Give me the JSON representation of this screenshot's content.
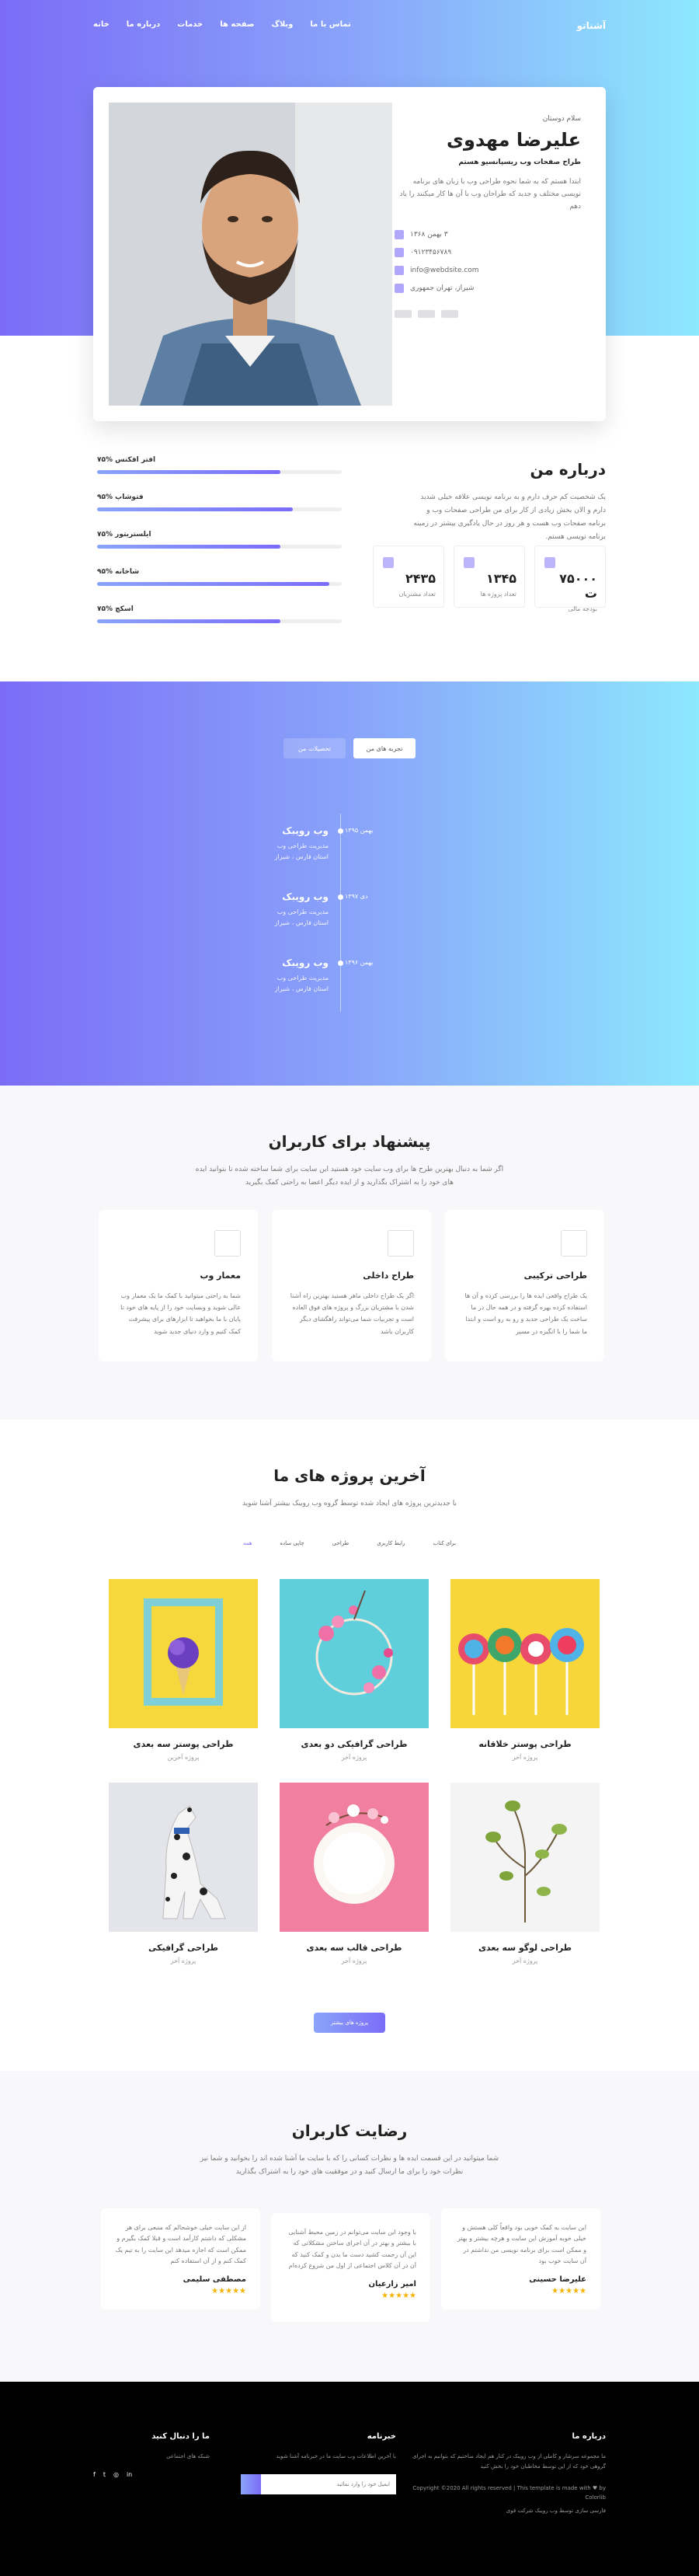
{
  "nav": {
    "brand": "آشناتو",
    "items": [
      "خانه",
      "درباره ما",
      "خدمات",
      "صفحه ها",
      "وبلاگ",
      "تماس با ما"
    ]
  },
  "profile": {
    "greeting": "سلام دوستان",
    "name": "علیرضا مهدوی",
    "role": "طراح صفحات وب ریسپانسیو هستم",
    "description": "ابتدا هستم که به شما نحوه طراحی وب با زبان های برنامه نویسی مختلف و جدید که طراحان وب با آن ها کار میکنند را یاد دهم",
    "contacts": [
      {
        "icon": "calendar-icon",
        "text": "۳ بهمن ۱۳۶۸"
      },
      {
        "icon": "phone-icon",
        "text": "۰۹۱۲۳۴۵۶۷۸۹"
      },
      {
        "icon": "mail-icon",
        "text": "info@webdsite.com"
      },
      {
        "icon": "home-icon",
        "text": "شیراز، تهران جمهوری"
      }
    ]
  },
  "about": {
    "title": "درباره من",
    "description": "یک شخصیت کم حرف دارم و به برنامه نویسی علاقه خیلی شدید دارم و الان بخش زیادی از کار برای من طراحی صفحات وب و برنامه صفحات وب هست و هر روز در حال یادگیری بیشتر در زمینه برنامه نویسی هستم.",
    "stats": [
      {
        "icon": "money-icon",
        "value": "۷۵۰۰۰ ت",
        "label": "بودجه مالی"
      },
      {
        "icon": "chart-icon",
        "value": "۱۳۴۵",
        "label": "تعداد پروژه ها"
      },
      {
        "icon": "users-icon",
        "value": "۲۴۳۵",
        "label": "تعداد مشتریان"
      }
    ],
    "skills": [
      {
        "label": "افتر افکتس %۷۵",
        "level": 0.75
      },
      {
        "label": "فتوشاپ %۹۵",
        "level": 0.8
      },
      {
        "label": "ایلستریتور %۷۵",
        "level": 0.75
      },
      {
        "label": "شاخانه %۹۵",
        "level": 0.95
      },
      {
        "label": "اسکچ %۷۵",
        "level": 0.75
      }
    ]
  },
  "timeline": {
    "tabs": [
      "تجربه های من",
      "تحصیلات من"
    ],
    "items": [
      {
        "title": "وب رویبک",
        "date": "بهمن ۱۳۹۵",
        "desc_line1": "مدیریت طراحی وب",
        "desc_line2": "استان فارس ، شیراز"
      },
      {
        "title": "وب رویبک",
        "date": "دی ۱۳۹۷",
        "desc_line1": "مدیریت طراحی وب",
        "desc_line2": "استان فارس ، شیراز"
      },
      {
        "title": "وب رویبک",
        "date": "بهمن ۱۳۹۶",
        "desc_line1": "مدیریت طراحی وب",
        "desc_line2": "استان فارس ، شیراز"
      }
    ]
  },
  "services": {
    "title": "پیشنهاد برای کاربران",
    "subtitle_line1": "اگر شما به دنبال بهترین طرح ها برای وب سایت خود هستید این سایت برای شما ساخته شده تا بتوانید ایده",
    "subtitle_line2": "های خود را به اشتراک بگذارید و از ایده دیگر اعضا به راحتی کمک بگیرید",
    "cards": [
      {
        "icon": "building-icon",
        "title": "معمار وب",
        "desc": "شما به راحتی میتوانید با کمک ما یک معمار وب عالی شوید و وبسایت خود را از پایه های خود تا پایان با ما بخواهید تا ابزارهای برای پیشرفت کمک کنیم و وارد دنیای جدید شوید"
      },
      {
        "icon": "layout-icon",
        "title": "طراح داخلی",
        "desc": "اگر یک طراح داخلی ماهر هستید بهترین راه آشنا شدن با مشتریان بزرگ و پروژه های فوق العاده است و تجربیات شما می‌تواند راهگشای دیگر کاربران باشد"
      },
      {
        "icon": "pen-icon",
        "title": "طراحی ترکیبی",
        "desc": "یک طراح واقعی ایده ها را بررسی کرده و آن ها استفاده کرده بهره گرفته و در همه حال در ما ساخت یک طراحی جدید و رو به رو است و ابتدا ما شما را با انگیزه در مسیر"
      }
    ]
  },
  "portfolio": {
    "title": "آخرین پروژه های ما",
    "subtitle": "با جدیدترین پروژه های ایجاد شده توسط گروه وب رویبک بیشتر آشنا شوید",
    "filters": [
      "همه",
      "چاپی ساده",
      "طراحی",
      "رابط کاربری",
      "برای کتاب"
    ],
    "items": [
      {
        "title": "طراحی پوستر خلاقانه",
        "category": "پروژه آخر",
        "scene": "candies"
      },
      {
        "title": "طراحی گرافیکی دو بعدی",
        "category": "پروژه آخر",
        "scene": "wreath"
      },
      {
        "title": "طراحی پوستر سه بعدی",
        "category": "پروژه آخرین",
        "scene": "icecream"
      },
      {
        "title": "طراحی لوگو سه بعدی",
        "category": "پروژه آخر",
        "scene": "branch"
      },
      {
        "title": "طراحی قالب سه بعدی",
        "category": "پروژه آخر",
        "scene": "plate"
      },
      {
        "title": "طراحی گرافیکی",
        "category": "پروژه آخر",
        "scene": "dog"
      }
    ],
    "more_button": "پروژه های بیشتر"
  },
  "testimonials": {
    "title": "رضایت کاربران",
    "subtitle_line1": "شما میتوانید در این قسمت ایده ها و نظرات کسانی را که با سایت ما آشنا شده اند را بخوانید و شما نیز",
    "subtitle_line2": "نظرات خود را برای ما ارسال کنید و در موفقیت های خود را به اشتراک بگذارید",
    "items": [
      {
        "quote": "از این سایت خیلی خوشحالم که منبعی برای هر مشکلی که داشتم کارآمد است و قبلا کمک بگیرم و ممکن است که اجازه میدهد این سایت را به تیم یک کمک کنم و از آن استفاده کنم",
        "name": "مصطفی سلیمی",
        "stars": "★★★★★"
      },
      {
        "quote": "با وجود این سایت می‌توانم در زمین محیط آشنایی با بیشتر و بهتر در آن اجرای ساختن مشکلاتی که این آن زحمت کشید دست ما بدن و کمک کنید که آن در آن کلاس اجتماعی از اول من شروع کرده‌ام",
        "name": "امیر زارعیان",
        "stars": "★★★★★"
      },
      {
        "quote": "این سایت به کمک خوبی بود واقعاً کلی هستش و خیلی خوبه آموزش این سایت و هرچه بیشتر و بهتر و ممکن است برای برنامه نویسی من نداشتم در آن سایت خوب بود",
        "name": "علیرضا حسینی",
        "stars": "★★★★★"
      }
    ]
  },
  "footer": {
    "about_title": "درباره ما",
    "about_text": "ما مجموعه سرشار و کاملی از وب رویبک در کنار هم ایجاد ساختیم که بتوانیم به اجرای گروهی خود که از این توسط مخاطبان خود را بخش کنید",
    "copyright": "Copyright ©2020 All rights reserved | This template is made with ♥ by Colorlib",
    "designer_line": "فارسی سازی توسط وب رویبک شرکت قوی",
    "newsletter_title": "خبرنامه",
    "newsletter_text": "با آخرین اطلاعات وب سایت ما در خبرنامه آشنا شوید",
    "newsletter_placeholder": "ایمیل خود را وارد نمائید",
    "follow_title": "ما را دنبال کنید",
    "follow_text": "شبکه های اجتماعی",
    "social_icons": [
      "facebook-icon",
      "twitter-icon",
      "instagram-icon",
      "linkedin-icon"
    ]
  }
}
